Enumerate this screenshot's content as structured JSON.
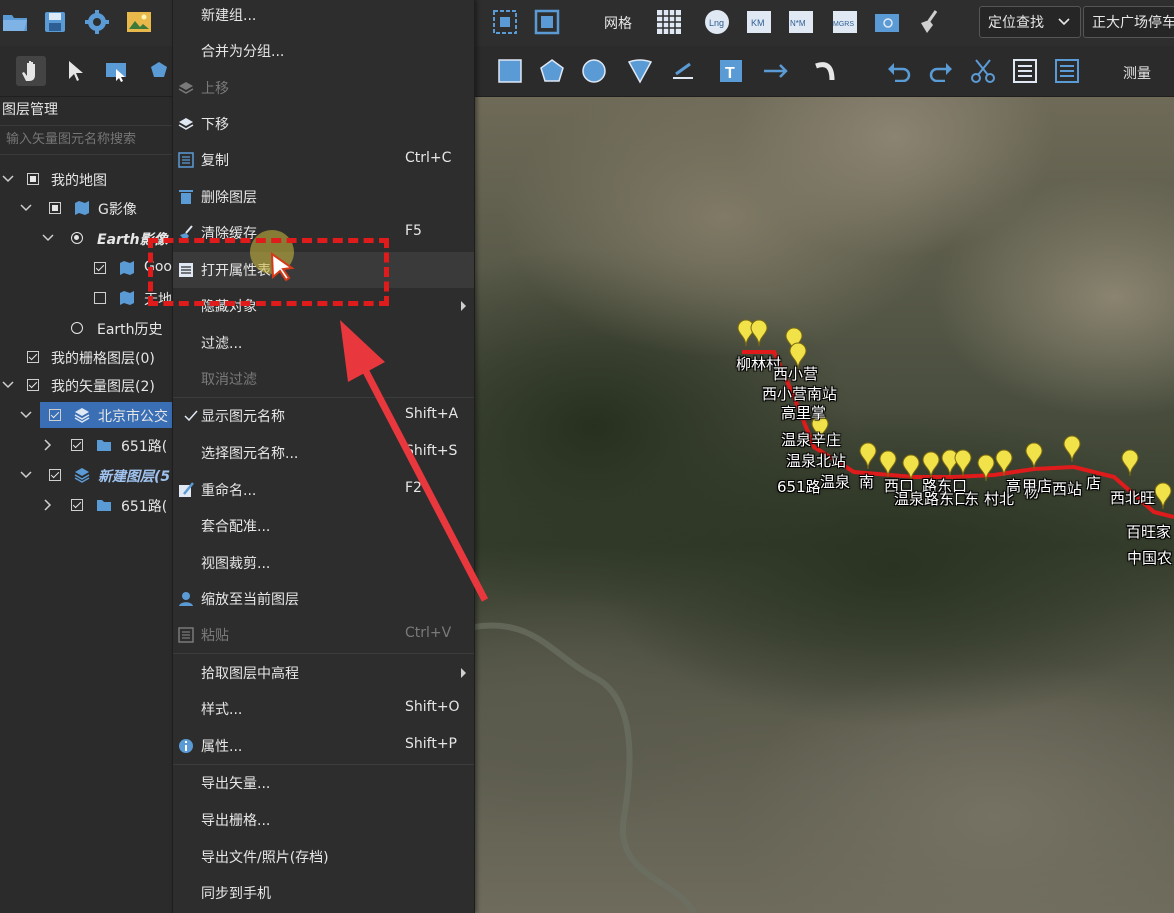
{
  "toolbar": {
    "grid_label": "网格",
    "measure_label": "测量",
    "locate_combo": "定位查找",
    "address_combo": "正大广场停车"
  },
  "panel": {
    "title": "图层管理",
    "search_placeholder": "输入矢量图元名称搜索",
    "tree": [
      {
        "label": "我的地图"
      },
      {
        "label": "G影像"
      },
      {
        "label": "Earth影像"
      },
      {
        "label": "Goo"
      },
      {
        "label": "天地"
      },
      {
        "label": "Earth历史"
      },
      {
        "label": "我的栅格图层(0)"
      },
      {
        "label": "我的矢量图层(2)"
      },
      {
        "label": "北京市公交"
      },
      {
        "label": "651路("
      },
      {
        "label": "新建图层(5"
      },
      {
        "label": "651路("
      }
    ]
  },
  "menu": {
    "items": [
      {
        "label": "新建组...",
        "shortcut": ""
      },
      {
        "label": "合并为分组...",
        "shortcut": ""
      },
      {
        "label": "上移",
        "shortcut": ""
      },
      {
        "label": "下移",
        "shortcut": ""
      },
      {
        "label": "复制",
        "shortcut": "Ctrl+C"
      },
      {
        "label": "删除图层",
        "shortcut": ""
      },
      {
        "label": "清除缓存",
        "shortcut": "F5"
      },
      {
        "label": "打开属性表",
        "shortcut": ""
      },
      {
        "label": "隐藏对象",
        "shortcut": ""
      },
      {
        "label": "过滤...",
        "shortcut": ""
      },
      {
        "label": "取消过滤",
        "shortcut": ""
      },
      {
        "label": "显示图元名称",
        "shortcut": "Shift+A"
      },
      {
        "label": "选择图元名称...",
        "shortcut": "Shift+S"
      },
      {
        "label": "重命名...",
        "shortcut": "F2"
      },
      {
        "label": "套合配准...",
        "shortcut": ""
      },
      {
        "label": "视图裁剪...",
        "shortcut": ""
      },
      {
        "label": "缩放至当前图层",
        "shortcut": ""
      },
      {
        "label": "粘贴",
        "shortcut": "Ctrl+V"
      },
      {
        "label": "拾取图层中高程",
        "shortcut": ""
      },
      {
        "label": "样式...",
        "shortcut": "Shift+O"
      },
      {
        "label": "属性...",
        "shortcut": "Shift+P"
      },
      {
        "label": "导出矢量...",
        "shortcut": ""
      },
      {
        "label": "导出栅格...",
        "shortcut": ""
      },
      {
        "label": "导出文件/照片(存档)",
        "shortcut": ""
      },
      {
        "label": "同步到手机",
        "shortcut": ""
      }
    ]
  },
  "map": {
    "labels": [
      "柳林村",
      "西小营",
      "西小营南站",
      "高里掌",
      "温泉辛庄",
      "温泉北站",
      "651路",
      "温泉",
      "南",
      "西口",
      "路东口",
      "温泉路东口",
      "东",
      "村北",
      "杨",
      "高",
      "甲",
      "店",
      "西站",
      "店",
      "西北旺",
      "百旺家",
      "中国农"
    ]
  },
  "colors": {
    "accent": "#3a6fb5",
    "highlight": "#e01b1b",
    "pin": "#f2e24a",
    "route": "#e01b1b"
  }
}
